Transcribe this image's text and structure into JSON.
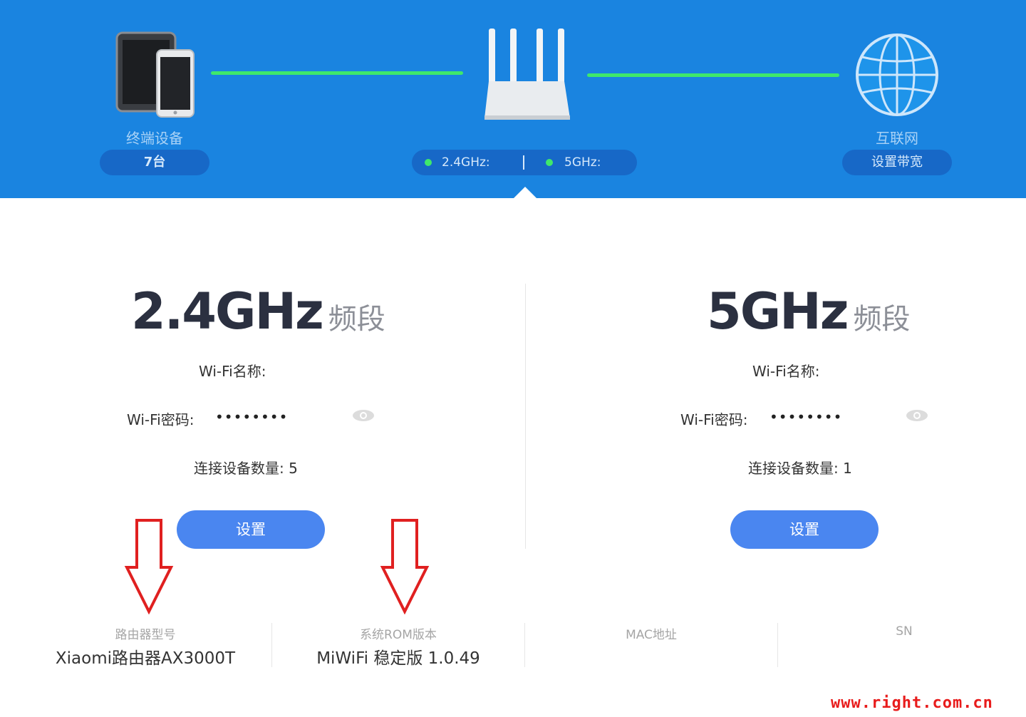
{
  "topology": {
    "devices": {
      "icon": "tablet-phone-icon",
      "label": "终端设备",
      "count": "7台"
    },
    "router": {
      "icon": "router-icon",
      "freq_24": "2.4GHz:",
      "freq_5": "5GHz:"
    },
    "internet": {
      "icon": "globe-icon",
      "label": "互联网",
      "action": "设置带宽"
    },
    "link_color": "#3fe86b",
    "bar_color": "#1a84e0"
  },
  "bands": [
    {
      "title_big": "2.4GHz",
      "title_small": "频段",
      "name_label": "Wi-Fi名称:",
      "password_label": "Wi-Fi密码:",
      "password_mask": "••••••••",
      "connected_label": "连接设备数量:",
      "connected_count": "5",
      "button": "设置"
    },
    {
      "title_big": "5GHz",
      "title_small": "频段",
      "name_label": "Wi-Fi名称:",
      "password_label": "Wi-Fi密码:",
      "password_mask": "••••••••",
      "connected_label": "连接设备数量:",
      "connected_count": "1",
      "button": "设置"
    }
  ],
  "info": [
    {
      "label": "路由器型号",
      "value": "Xiaomi路由器AX3000T"
    },
    {
      "label": "系统ROM版本",
      "value": "MiWiFi 稳定版 1.0.49"
    },
    {
      "label": "MAC地址",
      "value": ""
    },
    {
      "label": "SN",
      "value": ""
    }
  ],
  "watermark": "www.right.com.cn",
  "accent": "#4a86f0",
  "arrow_color": "#e02020"
}
